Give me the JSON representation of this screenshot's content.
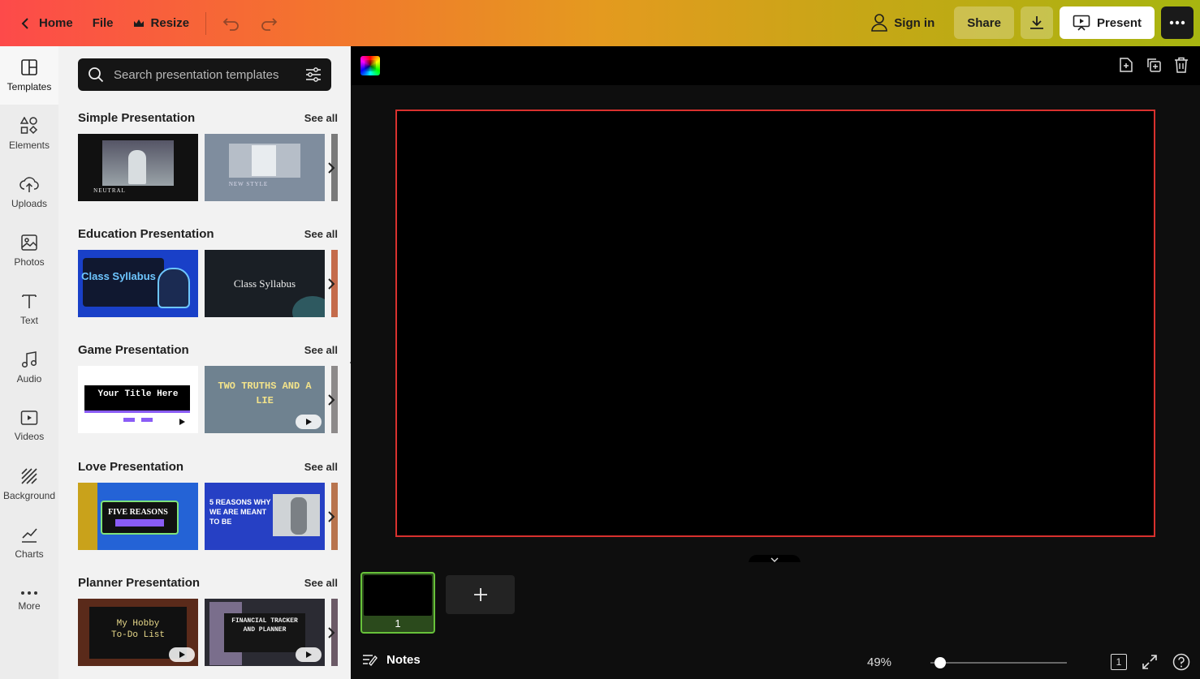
{
  "topbar": {
    "home_label": "Home",
    "file_label": "File",
    "resize_label": "Resize",
    "signin_label": "Sign in",
    "share_label": "Share",
    "present_label": "Present"
  },
  "rail": {
    "items": [
      {
        "label": "Templates",
        "icon": "templates-icon"
      },
      {
        "label": "Elements",
        "icon": "elements-icon"
      },
      {
        "label": "Uploads",
        "icon": "cloud-upload-icon"
      },
      {
        "label": "Photos",
        "icon": "image-icon"
      },
      {
        "label": "Text",
        "icon": "text-icon"
      },
      {
        "label": "Audio",
        "icon": "music-icon"
      },
      {
        "label": "Videos",
        "icon": "video-icon"
      },
      {
        "label": "Background",
        "icon": "background-pattern-icon"
      },
      {
        "label": "Charts",
        "icon": "line-chart-icon"
      },
      {
        "label": "More",
        "icon": "more-dots-icon"
      }
    ]
  },
  "panel": {
    "search_placeholder": "Search presentation templates",
    "see_all": "See all",
    "sections": [
      {
        "title": "Simple Presentation",
        "thumbs": [
          {
            "text": "NEUTRAL"
          },
          {
            "text": "NEW STYLE"
          }
        ]
      },
      {
        "title": "Education Presentation",
        "thumbs": [
          {
            "text": "Class Syllabus"
          },
          {
            "text": "Class Syllabus"
          }
        ]
      },
      {
        "title": "Game Presentation",
        "thumbs": [
          {
            "text": "Your Title Here"
          },
          {
            "text": "TWO TRUTHS AND A LIE"
          }
        ]
      },
      {
        "title": "Love Presentation",
        "thumbs": [
          {
            "text": "FIVE REASONS"
          },
          {
            "text": "5 REASONS WHY WE ARE MEANT TO BE"
          }
        ]
      },
      {
        "title": "Planner Presentation",
        "thumbs": [
          {
            "text": "My Hobby To-Do List"
          },
          {
            "text": "FINANCIAL TRACKER AND PLANNER"
          }
        ]
      }
    ]
  },
  "editor": {
    "page_number": "1",
    "notes_label": "Notes",
    "zoom": "49%",
    "pages_count": "1"
  },
  "colors": {
    "canvas_border": "#d8312e",
    "page_thumb_border": "#67c23a"
  }
}
